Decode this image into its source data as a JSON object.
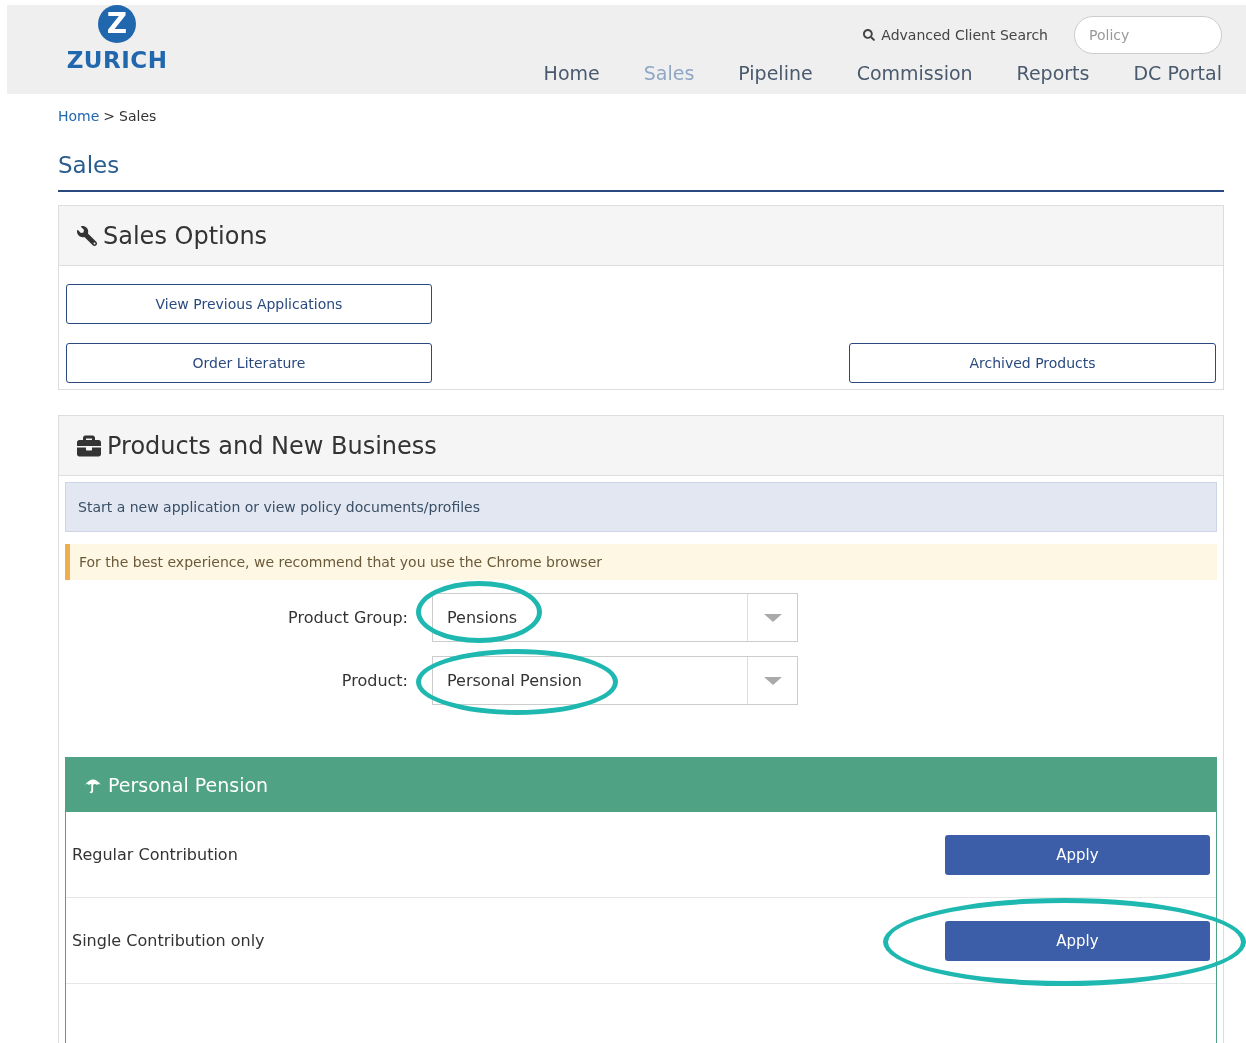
{
  "header": {
    "logo": {
      "mark": "Z",
      "name": "ZURICH"
    },
    "advanced_search": "Advanced Client Search",
    "policy_search": {
      "placeholder": "Policy"
    },
    "nav": [
      {
        "label": "Home",
        "selected": false
      },
      {
        "label": "Sales",
        "selected": true
      },
      {
        "label": "Pipeline",
        "selected": false
      },
      {
        "label": "Commission",
        "selected": false
      },
      {
        "label": "Reports",
        "selected": false
      },
      {
        "label": "DC Portal",
        "selected": false
      }
    ]
  },
  "breadcrumb": [
    {
      "label": "Home",
      "kind": "link"
    },
    {
      "label": ">",
      "kind": "separator"
    },
    {
      "label": "Sales",
      "kind": "current"
    }
  ],
  "page_title": "Sales",
  "sales_options": {
    "title": "Sales Options",
    "buttons": [
      {
        "label": "View Previous Applications"
      },
      {
        "label": "Order Literature"
      },
      {
        "label": "Archived Products"
      }
    ]
  },
  "products": {
    "title": "Products and New Business",
    "info": "Start a new application or view policy documents/profiles",
    "warning": "For the best experience, we recommend that you use the Chrome browser",
    "fields": [
      {
        "label": "Product Group:",
        "value": "Pensions",
        "circled": true
      },
      {
        "label": "Product:",
        "value": "Personal Pension",
        "circled": true
      }
    ],
    "product_panel": {
      "title": "Personal Pension",
      "rows": [
        {
          "name": "Regular Contribution",
          "button": "Apply",
          "circled": false
        },
        {
          "name": "Single Contribution only",
          "button": "Apply",
          "circled": true
        }
      ]
    }
  }
}
